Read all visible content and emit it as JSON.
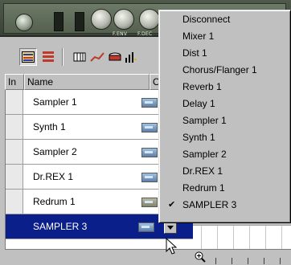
{
  "rack": {
    "knob_labels": [
      "F.ENV",
      "F.DEC"
    ]
  },
  "toolbar": {
    "buttons": [
      {
        "name": "arrange-view-icon",
        "pressed": true
      },
      {
        "name": "edit-view-icon",
        "pressed": false
      },
      {
        "name": "pencil-tool-icon",
        "pressed": false
      },
      {
        "name": "line-tool-icon",
        "pressed": false
      },
      {
        "name": "drum-icon",
        "pressed": false
      },
      {
        "name": "bars-icon",
        "pressed": false
      }
    ]
  },
  "tracklist": {
    "headers": {
      "in": "In",
      "name": "Name",
      "out": "O"
    },
    "tracks": [
      {
        "name": "Sampler 1",
        "selected": false
      },
      {
        "name": "Synth 1",
        "selected": false
      },
      {
        "name": "Sampler 2",
        "selected": false
      },
      {
        "name": "Dr.REX 1",
        "selected": false
      },
      {
        "name": "Redrum 1",
        "selected": false
      },
      {
        "name": "SAMPLER 3",
        "selected": true
      }
    ]
  },
  "menu": {
    "items": [
      {
        "label": "Disconnect",
        "checked": false
      },
      {
        "label": "Mixer 1",
        "checked": false
      },
      {
        "label": "Dist 1",
        "checked": false
      },
      {
        "label": "Chorus/Flanger 1",
        "checked": false
      },
      {
        "label": "Reverb 1",
        "checked": false
      },
      {
        "label": "Delay 1",
        "checked": false
      },
      {
        "label": "Sampler 1",
        "checked": false
      },
      {
        "label": "Synth 1",
        "checked": false
      },
      {
        "label": "Sampler 2",
        "checked": false
      },
      {
        "label": "Dr.REX 1",
        "checked": false
      },
      {
        "label": "Redrum 1",
        "checked": false
      },
      {
        "label": "SAMPLER 3",
        "checked": true
      }
    ],
    "check_glyph": "✔"
  },
  "colors": {
    "selection": "#0a1f8a",
    "face": "#c0c0c0"
  }
}
